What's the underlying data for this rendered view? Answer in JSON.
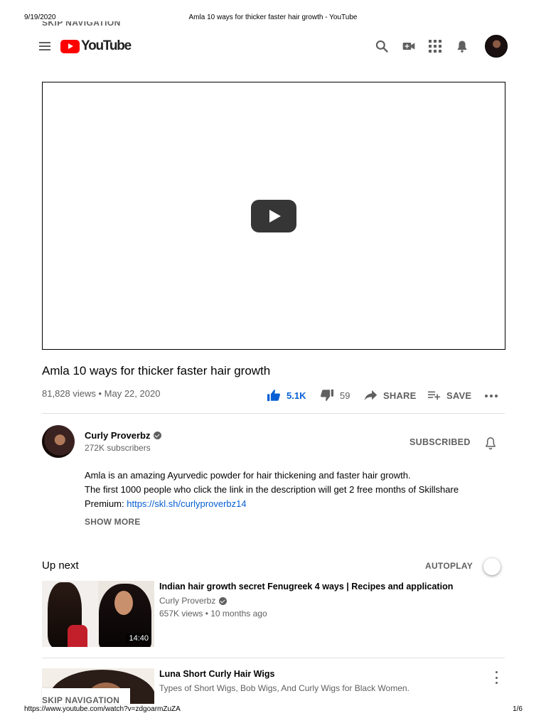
{
  "print": {
    "date": "9/19/2020",
    "title": "Amla 10 ways for thicker faster hair growth - YouTube",
    "url": "https://www.youtube.com/watch?v=zdgoarmZuZA",
    "page": "1/6"
  },
  "masthead": {
    "skip_navigation": "SKIP NAVIGATION",
    "logo_text": "YouTube",
    "icons": [
      "menu-icon",
      "search-icon",
      "create-video-icon",
      "apps-icon",
      "notifications-icon"
    ]
  },
  "video": {
    "title": "Amla 10 ways for thicker faster hair growth",
    "views_date": "81,828 views • May 22, 2020",
    "likes": "5.1K",
    "dislikes": "59",
    "share_label": "SHARE",
    "save_label": "SAVE"
  },
  "channel": {
    "name": "Curly Proverbz",
    "subscribers": "272K subscribers",
    "subscribe_state": "SUBSCRIBED"
  },
  "description": {
    "line1": "Amla is an amazing Ayurvedic powder for hair thickening and faster hair growth.",
    "line2": "The first 1000 people who click the link in the description will get 2 free months of Skillshare",
    "line3_prefix": "Premium:",
    "link": "https://skl.sh/curlyproverbz14",
    "show_more": "SHOW MORE"
  },
  "up_next": {
    "title": "Up next",
    "autoplay_label": "AUTOPLAY",
    "autoplay_on": false,
    "items": [
      {
        "title": "Indian hair growth secret Fenugreek 4 ways | Recipes and application",
        "channel": "Curly Proverbz",
        "meta": "657K views • 10 months ago",
        "duration": "14:40"
      },
      {
        "title": "Luna Short Curly Hair Wigs",
        "description": "Types of Short Wigs, Bob Wigs, And Curly Wigs for Black Women."
      }
    ]
  },
  "colors": {
    "youtube_red": "#ff0000",
    "link_blue": "#065fd4",
    "secondary_text": "#606060"
  }
}
